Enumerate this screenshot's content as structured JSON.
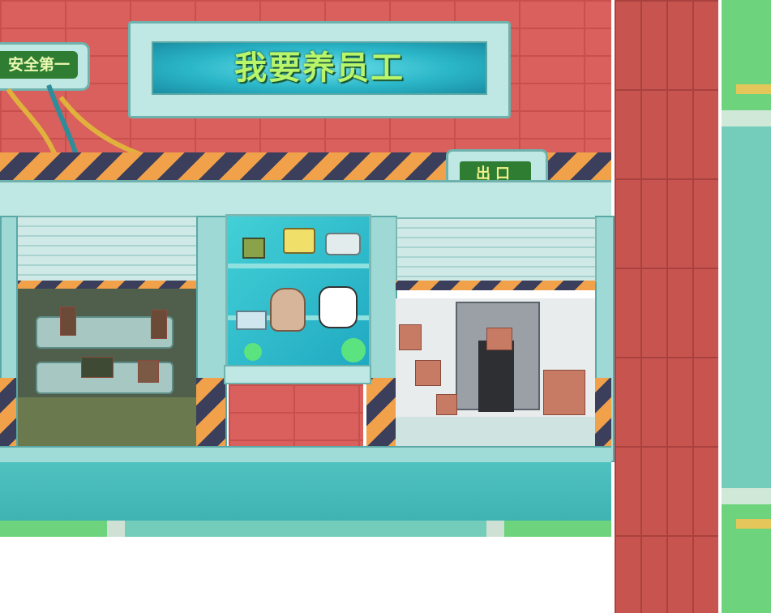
{
  "scene": {
    "sign_left": {
      "text": "安全第一"
    },
    "banner": {
      "text": "我要养员工"
    },
    "exit_sign": {
      "text": "出口"
    }
  },
  "colors": {
    "brick": "#d9605c",
    "floor": "#4fc2c0",
    "green_lane": "#6dd37c",
    "teal_panel": "#74cdbb",
    "hazard_orange": "#f0a14a",
    "hazard_dark": "#3b3f5c"
  }
}
